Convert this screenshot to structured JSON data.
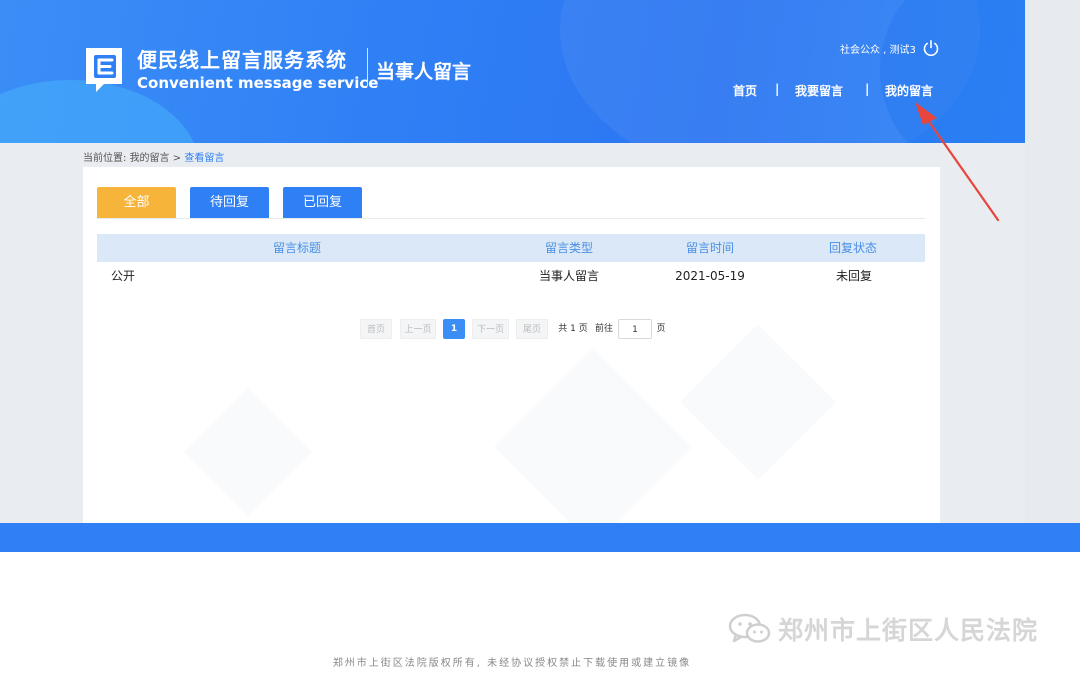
{
  "header": {
    "title_cn": "便民线上留言服务系统",
    "title_en": "Convenient message service",
    "role": "当事人留言",
    "user_name": "社会公众 , 测试3",
    "nav": {
      "home": "首页",
      "leave_message": "我要留言",
      "my_messages": "我的留言",
      "separator": "|"
    },
    "icons": {
      "logo": "message-logo-icon",
      "power": "power-icon"
    }
  },
  "breadcrumb": {
    "prefix": "当前位置:",
    "parent": "我的留言",
    "arrow": ">",
    "current": "查看留言"
  },
  "tabs": [
    {
      "label": "全部",
      "active": true
    },
    {
      "label": "待回复",
      "active": false
    },
    {
      "label": "已回复",
      "active": false
    }
  ],
  "table": {
    "columns": [
      "留言标题",
      "留言类型",
      "留言时间",
      "回复状态"
    ],
    "rows": [
      [
        "公开",
        "当事人留言",
        "2021-05-19",
        "未回复"
      ]
    ]
  },
  "pagination": {
    "first": "首页",
    "prev": "上一页",
    "current_page": "1",
    "next": "下一页",
    "last": "尾页",
    "total": "共 1 页",
    "goto": "前往",
    "goto_value": "1",
    "unit": "页"
  },
  "footer": {
    "watermark": "郑州市上街区人民法院",
    "copyright": "郑州市上街区法院版权所有, 未经协议授权禁止下载使用或建立镜像"
  },
  "colors": {
    "brand_blue": "#2f7ff5",
    "tab_active": "#f6b53a",
    "table_header": "#dbe8f7",
    "annotation_arrow": "#e8453c"
  }
}
